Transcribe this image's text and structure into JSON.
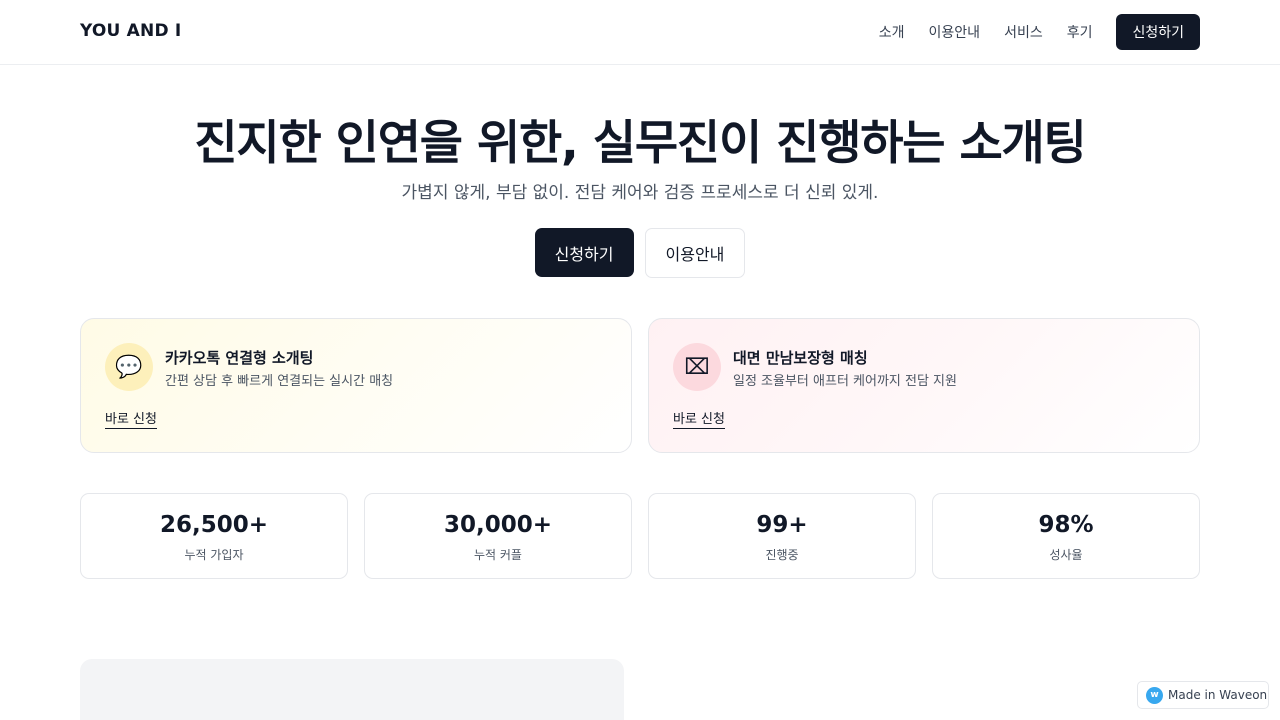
{
  "header": {
    "logo": "YOU AND I",
    "nav": [
      "소개",
      "이용안내",
      "서비스",
      "후기"
    ],
    "cta": "신청하기"
  },
  "hero": {
    "title": "진지한 인연을 위한, 실무진이 진행하는 소개팅",
    "subtitle": "가볍지 않게, 부담 없이. 전담 케어와 검증 프로세스로 더 신뢰 있게.",
    "primary_button": "신청하기",
    "secondary_button": "이용안내"
  },
  "services": [
    {
      "icon": "chat-bubble-icon",
      "icon_glyph": "💬",
      "title": "카카오톡 연결형 소개팅",
      "description": "간편 상담 후 빠르게 연결되는 실시간 매칭",
      "link": "바로 신청",
      "accent": "#fdf0bb"
    },
    {
      "icon": "meeting-icon",
      "icon_glyph": "⌧",
      "title": "대면 만남보장형 매칭",
      "description": "일정 조율부터 애프터 케어까지 전담 지원",
      "link": "바로 신청",
      "accent": "#fcd9de"
    }
  ],
  "stats": [
    {
      "value": "26,500+",
      "label": "누적 가입자"
    },
    {
      "value": "30,000+",
      "label": "누적 커플"
    },
    {
      "value": "99+",
      "label": "진행중"
    },
    {
      "value": "98%",
      "label": "성사율"
    }
  ],
  "badge": {
    "icon_glyph": "w",
    "text": "Made in Waveon"
  },
  "colors": {
    "primary": "#111827",
    "border": "#e5e7eb",
    "muted_text": "#4b5563"
  }
}
